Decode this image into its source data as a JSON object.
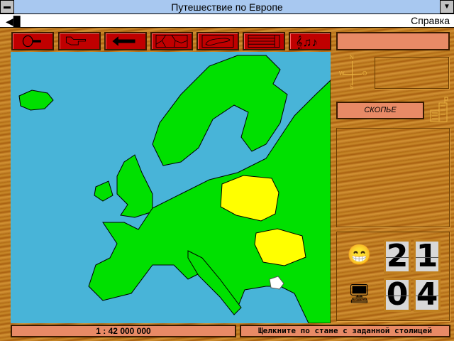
{
  "window": {
    "title": "Путешествие по Европе"
  },
  "menu": {
    "help": "Справка"
  },
  "toolbar": {
    "tools": [
      {
        "icon": "magnifier-icon"
      },
      {
        "icon": "pointing-hand-icon"
      },
      {
        "icon": "back-arrow-icon"
      },
      {
        "icon": "borders-map-icon"
      },
      {
        "icon": "country-outline-icon"
      },
      {
        "icon": "list-icon"
      },
      {
        "icon": "music-icon"
      }
    ],
    "info_field": ""
  },
  "compass": {
    "n": "N",
    "s": "S",
    "w": "W",
    "e": "O"
  },
  "city": {
    "label": "СКОПЬЕ"
  },
  "scores": {
    "player": [
      "2",
      "1"
    ],
    "computer": [
      "0",
      "4"
    ]
  },
  "colors": {
    "ocean": "#48b4d8",
    "land": "#00e000",
    "highlight": "#ffff00"
  },
  "status": {
    "scale": "1 : 42 000 000",
    "message": "Щелкните по стане с заданной столицей"
  }
}
